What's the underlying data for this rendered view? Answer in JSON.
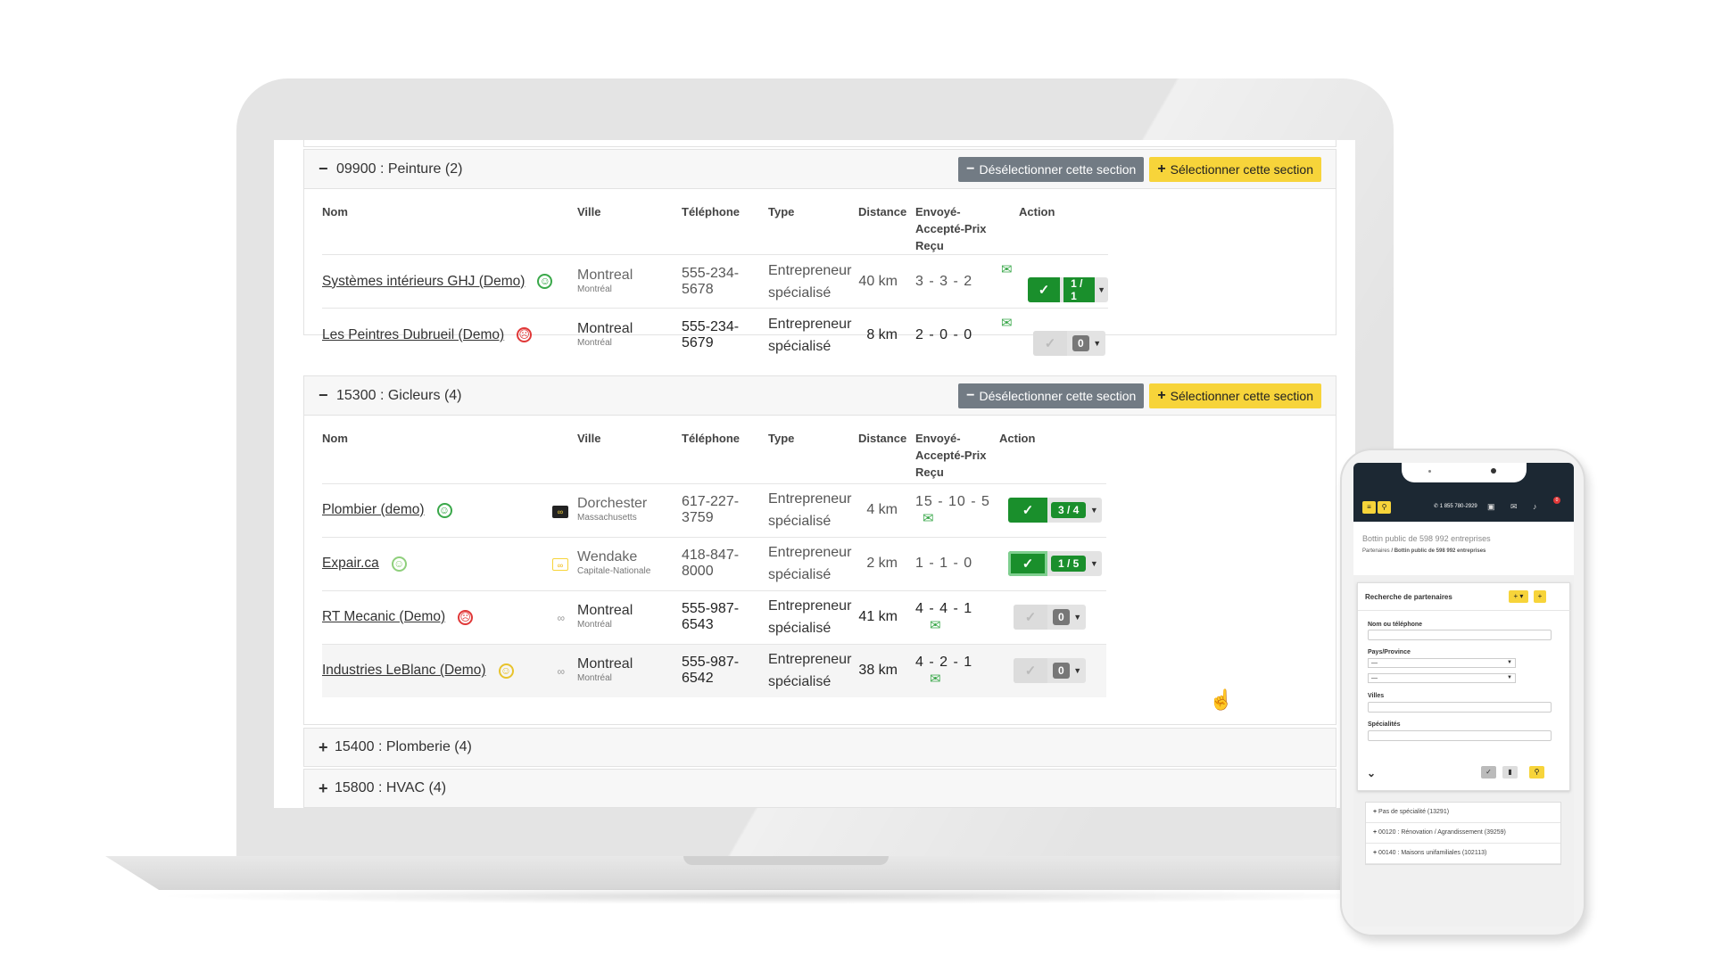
{
  "sections": [
    {
      "toggle": "−",
      "title": "09900 : Peinture (2)",
      "deselect_label": "Désélectionner cette section",
      "select_label": "Sélectionner cette section",
      "headers": [
        "Nom",
        "Ville",
        "Téléphone",
        "Type",
        "Distance",
        "Envoyé-Accepté-Prix Reçu",
        "Action"
      ],
      "rows": [
        {
          "name": "Systèmes intérieurs GHJ (Demo)",
          "face": "happy",
          "face_glyph": "☺",
          "logo": "",
          "city": "Montreal",
          "prov": "Montréal",
          "phone": "555-234-5678",
          "type": "Entrepreneur spécialisé",
          "distance": "40 km",
          "stats": "3 - 3 - 2",
          "mail": "✉",
          "action_on": true,
          "count": "1 / 1"
        },
        {
          "name": "Les Peintres Dubrueil (Demo)",
          "face": "sad",
          "face_glyph": "☹",
          "logo": "",
          "city": "Montreal",
          "prov": "Montréal",
          "phone": "555-234-5679",
          "type": "Entrepreneur spécialisé",
          "distance": "8 km",
          "stats": "2 - 0 - 0",
          "mail": "✉",
          "action_on": false,
          "count": "0"
        }
      ]
    },
    {
      "toggle": "−",
      "title": "15300 : Gicleurs (4)",
      "deselect_label": "Désélectionner cette section",
      "select_label": "Sélectionner cette section",
      "headers": [
        "Nom",
        "Ville",
        "Téléphone",
        "Type",
        "Distance",
        "Envoyé-Accepté-Prix Reçu",
        "Action"
      ],
      "rows": [
        {
          "name": "Plombier (demo)",
          "face": "happy",
          "face_glyph": "☺",
          "logo": "∞",
          "city": "Dorchester",
          "prov": "Massachusetts",
          "phone": "617-227-3759",
          "type": "Entrepreneur spécialisé",
          "distance": "4 km",
          "stats": "15 - 10 - 5",
          "mail": "✉",
          "action_on": true,
          "count": "3 / 4"
        },
        {
          "name": "Expair.ca",
          "face": "light",
          "face_glyph": "☺",
          "logo": "∞",
          "city": "Wendake",
          "prov": "Capitale-Nationale",
          "phone": "418-847-8000",
          "type": "Entrepreneur spécialisé",
          "distance": "2 km",
          "stats": "1 - 1 - 0",
          "mail": "",
          "action_on": true,
          "count": "1 / 5"
        },
        {
          "name": "RT Mecanic (Demo)",
          "face": "sad",
          "face_glyph": "☹",
          "logo": "∞",
          "city": "Montreal",
          "prov": "Montréal",
          "phone": "555-987-6543",
          "type": "Entrepreneur spécialisé",
          "distance": "41 km",
          "stats": "4 - 4 - 1",
          "mail": "✉",
          "action_on": false,
          "count": "0"
        },
        {
          "name": "Industries LeBlanc (Demo)",
          "face": "neutral",
          "face_glyph": "☺",
          "logo": "∞",
          "city": "Montreal",
          "prov": "Montréal",
          "phone": "555-987-6542",
          "type": "Entrepreneur spécialisé",
          "distance": "38 km",
          "stats": "4 - 2 - 1",
          "mail": "✉",
          "action_on": false,
          "count": "0"
        }
      ]
    }
  ],
  "collapsed_sections": [
    {
      "toggle": "+",
      "title": "15400 : Plomberie (4)"
    },
    {
      "toggle": "+",
      "title": "15800 : HVAC (4)"
    }
  ],
  "mobile": {
    "menu_icon": "≡",
    "search_icon": "⚲",
    "phone_number": "1 855 780-2929",
    "notif_count": "0",
    "intro_title": "Bottin public de 598 992 entreprises",
    "breadcrumb_root": "Partenaires",
    "breadcrumb_current": " / Bottin public de 598 992 entreprises",
    "search_title": "Recherche de partenaires",
    "field_name_label": "Nom ou téléphone",
    "field_country_label": "Pays/Province",
    "select_placeholder": "—",
    "field_cities_label": "Villes",
    "field_specialties_label": "Spécialités",
    "list": [
      "Pas de spécialité (13291)",
      "00120 : Rénovation / Agrandissement (39259)",
      "00140 : Maisons unifamiliales (102113)"
    ]
  },
  "colors": {
    "accent_yellow": "#f7d43a",
    "success_green": "#1a8f2c",
    "nav_dark": "#1c2833"
  }
}
